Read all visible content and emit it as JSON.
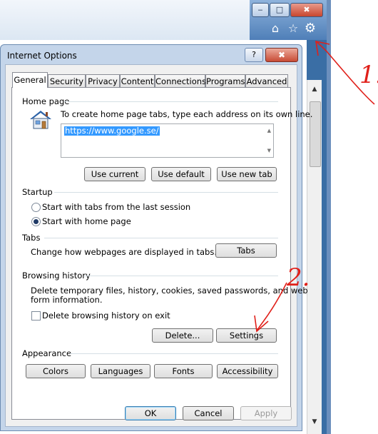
{
  "browser": {
    "minimize_glyph": "‒",
    "maximize_glyph": "□",
    "close_glyph": "✖",
    "home_glyph": "⌂",
    "favorites_glyph": "☆",
    "gear_glyph": "⚙",
    "scroll_up_glyph": "▲",
    "scroll_down_glyph": "▼"
  },
  "dialog": {
    "title": "Internet Options",
    "help_glyph": "?",
    "close_glyph": "✖",
    "tabs": [
      {
        "label": "General",
        "active": true
      },
      {
        "label": "Security"
      },
      {
        "label": "Privacy"
      },
      {
        "label": "Content"
      },
      {
        "label": "Connections"
      },
      {
        "label": "Programs"
      },
      {
        "label": "Advanced"
      }
    ],
    "home_page": {
      "group_label": "Home page",
      "description": "To create home page tabs, type each address on its own line.",
      "url_value": "https://www.google.se/",
      "buttons": {
        "use_current": "Use current",
        "use_default": "Use default",
        "use_new_tab": "Use new tab"
      }
    },
    "startup": {
      "group_label": "Startup",
      "options": [
        {
          "label": "Start with tabs from the last session",
          "selected": false
        },
        {
          "label": "Start with home page",
          "selected": true
        }
      ]
    },
    "tabs_section": {
      "group_label": "Tabs",
      "description": "Change how webpages are displayed in tabs.",
      "button": "Tabs"
    },
    "browsing_history": {
      "group_label": "Browsing history",
      "description_line1": "Delete temporary files, history, cookies, saved passwords, and web",
      "description_line2": "form information.",
      "checkbox_label": "Delete browsing history on exit",
      "checkbox_checked": false,
      "delete_button": "Delete...",
      "settings_button": "Settings"
    },
    "appearance": {
      "group_label": "Appearance",
      "buttons": [
        "Colors",
        "Languages",
        "Fonts",
        "Accessibility"
      ]
    },
    "footer": {
      "ok": "OK",
      "cancel": "Cancel",
      "apply": "Apply",
      "apply_enabled": false
    }
  },
  "annotations": {
    "label_1": "1.",
    "label_2": "2.",
    "ink_color": "#e0201a"
  }
}
